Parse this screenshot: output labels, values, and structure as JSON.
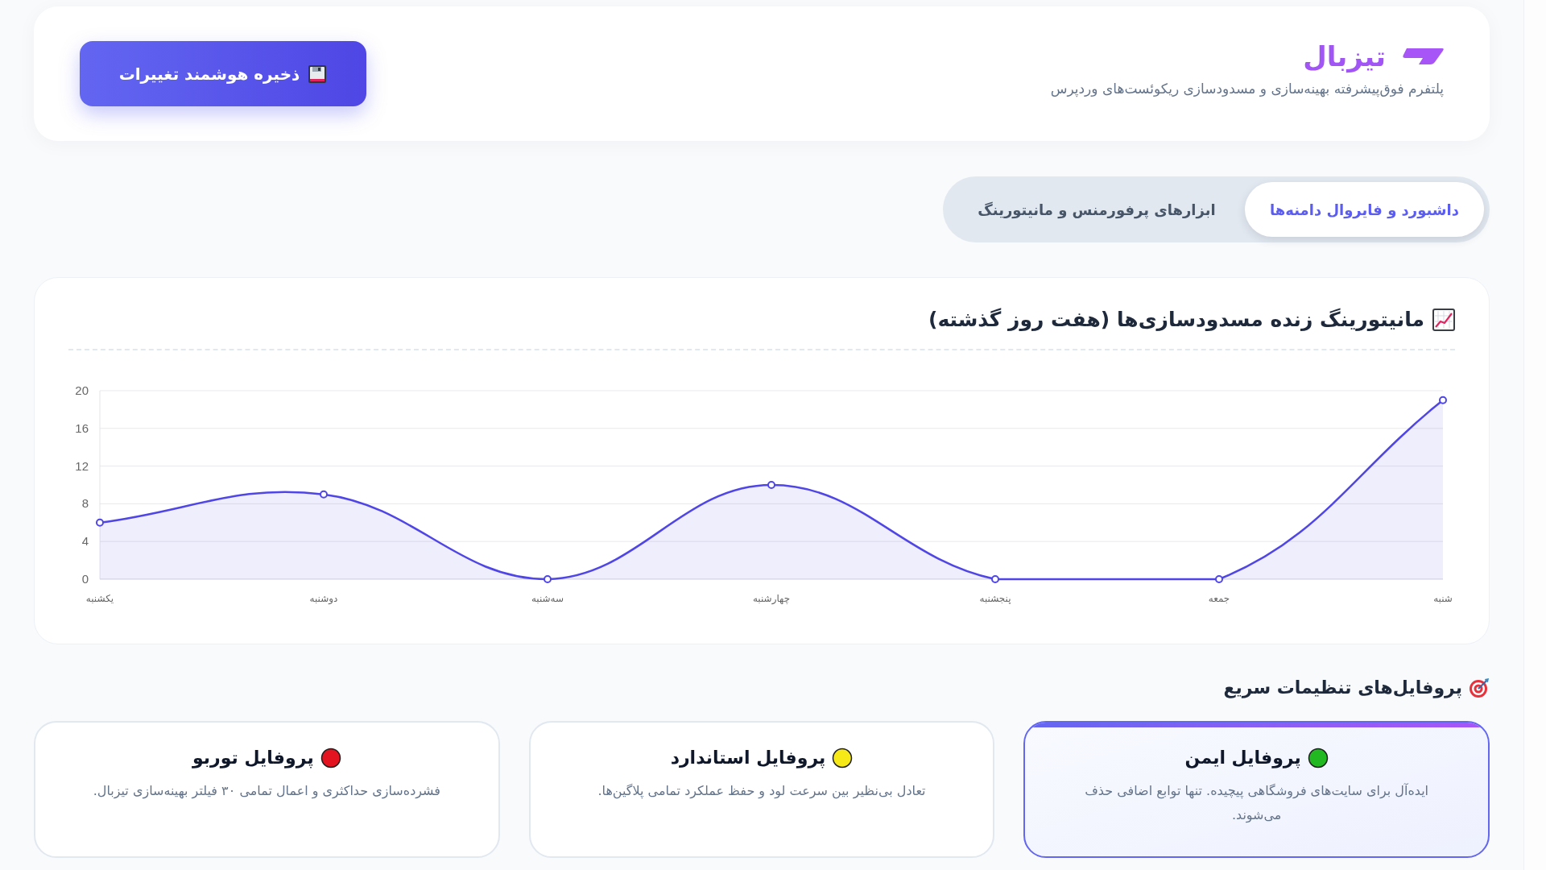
{
  "header": {
    "brand_name": "تیزبال",
    "tagline": "پلتفرم فوق‌پیشرفته بهینه‌سازی و مسدودسازی ریکوئست‌های وردپرس",
    "save_button": "ذخیره هوشمند تغییرات"
  },
  "tabs": [
    {
      "label": "داشبورد و فایروال دامنه‌ها",
      "selected": true
    },
    {
      "label": "ابزارهای پرفورمنس و مانیتورینگ",
      "selected": false
    }
  ],
  "chart_card": {
    "title": "مانیتورینگ زنده مسدودسازی‌ها (هفت روز گذشته)",
    "chart_data": {
      "type": "area",
      "categories": [
        "یکشنبه",
        "دوشنبه",
        "سه‌شنبه",
        "چهارشنبه",
        "پنجشنبه",
        "جمعه",
        "شنبه"
      ],
      "series": [
        {
          "color": "#4f46e5",
          "values": [
            6,
            9,
            0,
            10,
            0,
            0,
            19
          ]
        }
      ],
      "ylim": [
        0,
        20
      ],
      "yticks": [
        0,
        4,
        8,
        12,
        16,
        20
      ],
      "grid": true
    }
  },
  "profiles_section": {
    "title": "پروفایل‌های تنظیمات سریع",
    "profiles": [
      {
        "title": "پروفایل ایمن",
        "description": "ایده‌آل برای سایت‌های فروشگاهی پیچیده. تنها توابع اضافی حذف می‌شوند.",
        "color": "#22b822",
        "selected": true
      },
      {
        "title": "پروفایل استاندارد",
        "description": "تعادل بی‌نظیر بین سرعت لود و حفظ عملکرد تمامی پلاگین‌ها.",
        "color": "#f7e817",
        "selected": false
      },
      {
        "title": "پروفایل توربو",
        "description": "فشرده‌سازی حداکثری و اعمال تمامی ۳۰ فیلتر بهینه‌سازی تیزبال.",
        "color": "#e3141f",
        "selected": false
      }
    ]
  }
}
